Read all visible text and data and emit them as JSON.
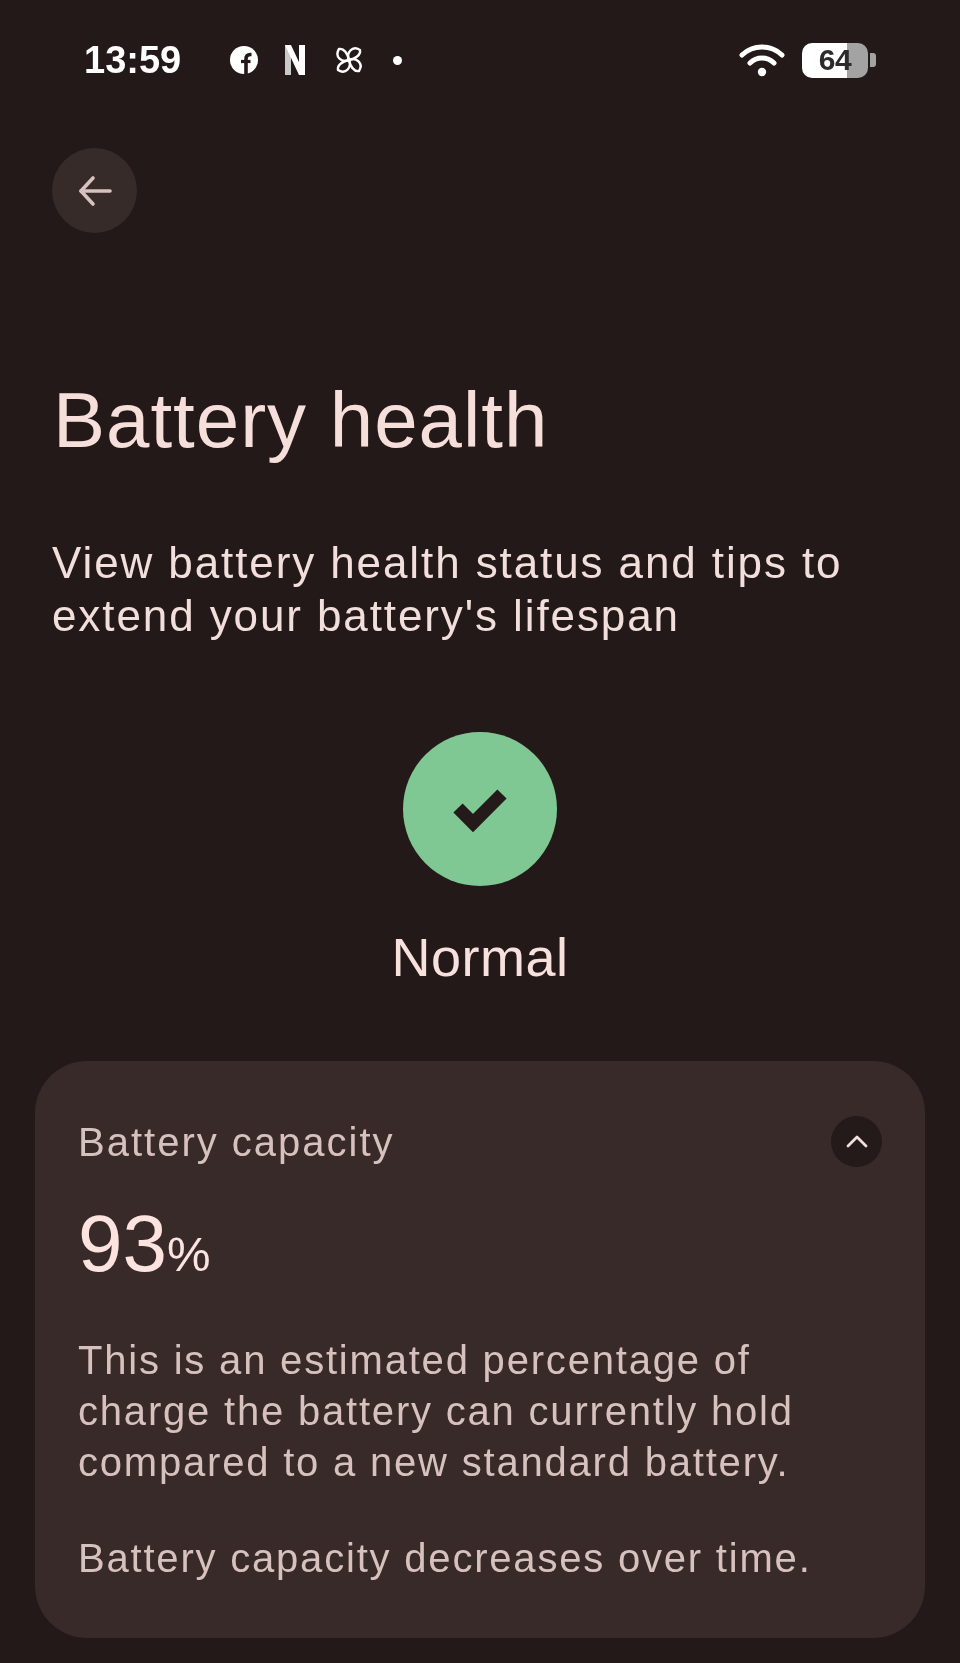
{
  "status_bar": {
    "time": "13:59",
    "battery": "64"
  },
  "title": "Battery health",
  "subtitle": "View battery health status and tips to extend your battery's lifespan",
  "health": {
    "label": "Normal"
  },
  "card": {
    "title": "Battery capacity",
    "expanded": true,
    "value": "93",
    "unit": "%",
    "description": "This is an estimated percentage of charge the battery can currently hold compared to a new standard battery.",
    "note": "Battery capacity decreases over time."
  }
}
